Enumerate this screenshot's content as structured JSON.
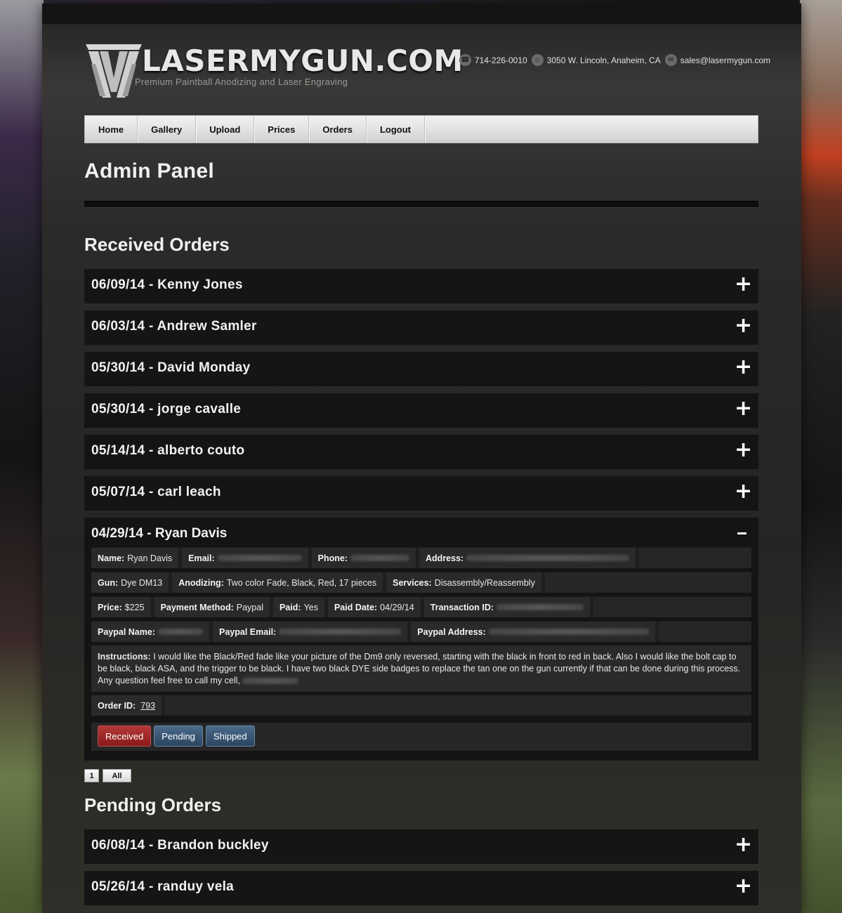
{
  "site": {
    "brand": "LASERMYGUN.COM",
    "tagline": "Premium Paintball Anodizing and Laser Engraving",
    "phone": "714-226-0010",
    "address": "3050 W. Lincoln, Anaheim, CA",
    "email": "sales@lasermygun.com"
  },
  "nav": [
    "Home",
    "Gallery",
    "Upload",
    "Prices",
    "Orders",
    "Logout"
  ],
  "page_title": "Admin Panel",
  "received": {
    "heading": "Received Orders",
    "orders": [
      "06/09/14 - Kenny Jones",
      "06/03/14 - Andrew Samler",
      "05/30/14 - David Monday",
      "05/30/14 - jorge cavalle",
      "05/14/14 - alberto couto",
      "05/07/14 - carl leach"
    ],
    "expanded": {
      "title": "04/29/14 - Ryan Davis",
      "name_label": "Name:",
      "name": "Ryan Davis",
      "email_label": "Email:",
      "phone_label": "Phone:",
      "address_label": "Address:",
      "gun_label": "Gun:",
      "gun": "Dye DM13",
      "anodizing_label": "Anodizing:",
      "anodizing": "Two color Fade, Black, Red, 17 pieces",
      "services_label": "Services:",
      "services": "Disassembly/Reassembly",
      "price_label": "Price:",
      "price": "$225",
      "payment_method_label": "Payment Method:",
      "payment_method": "Paypal",
      "paid_label": "Paid:",
      "paid": "Yes",
      "paid_date_label": "Paid Date:",
      "paid_date": "04/29/14",
      "transaction_label": "Transaction ID:",
      "paypal_name_label": "Paypal Name:",
      "paypal_email_label": "Paypal Email:",
      "paypal_address_label": "Paypal Address:",
      "instructions_label": "Instructions:",
      "instructions": "I would like the Black/Red fade like your picture of the Dm9 only reversed, starting with the black in front to red in back. Also I would like the bolt cap to be black, black ASA, and the trigger to be black. I have two black DYE side badges to replace the tan one on the gun currently if that can be done during this process. Any question feel free to call my cell,",
      "order_id_label": "Order ID:",
      "order_id": "793",
      "buttons": {
        "received": "Received",
        "pending": "Pending",
        "shipped": "Shipped"
      }
    }
  },
  "pager": {
    "page": "1",
    "all": "All"
  },
  "pending": {
    "heading": "Pending Orders",
    "orders": [
      "06/08/14 - Brandon buckley",
      "05/26/14 - randuy vela"
    ]
  },
  "icons": {
    "expand": "plus-icon",
    "collapse": "minus-icon"
  }
}
